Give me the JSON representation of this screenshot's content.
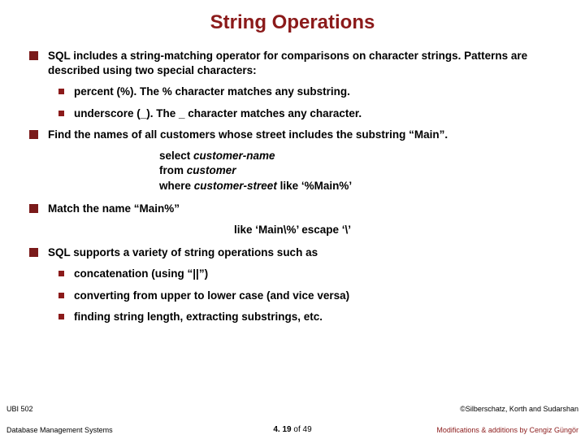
{
  "title": "String Operations",
  "bullets": {
    "b1": "SQL includes a string-matching operator for comparisons on character strings.  Patterns are described using two special characters:",
    "b1s1": "percent (%).  The % character matches any substring.",
    "b1s2": "underscore (_).  The _ character matches any character.",
    "b2": "Find the names of all customers whose street includes the substring “Main”.",
    "code_l1_kw": "select ",
    "code_l1_it": "customer-name",
    "code_l2_kw": "from ",
    "code_l2_it": "customer",
    "code_l3_kw": "where ",
    "code_l3_it": "customer-street ",
    "code_l3_kw2": "like ",
    "code_l3_lit": "‘%Main%’",
    "b3": "Match the name “Main%”",
    "escape_line": "like ‘Main\\%’ escape  ‘\\’",
    "b4": "SQL supports a variety of string operations such as",
    "b4s1": "concatenation (using “||”)",
    "b4s2": " converting from upper to lower case (and vice versa)",
    "b4s3": " finding string length, extracting substrings, etc."
  },
  "footer": {
    "course_code": "UBI 502",
    "course_name": "Database Management Systems",
    "copyright": "©Silberschatz, Korth and Sudarshan",
    "modifications": "Modifications & additions by Cengiz Güngör",
    "page_current": "4. 19",
    "page_of": " of ",
    "page_total": "49"
  }
}
